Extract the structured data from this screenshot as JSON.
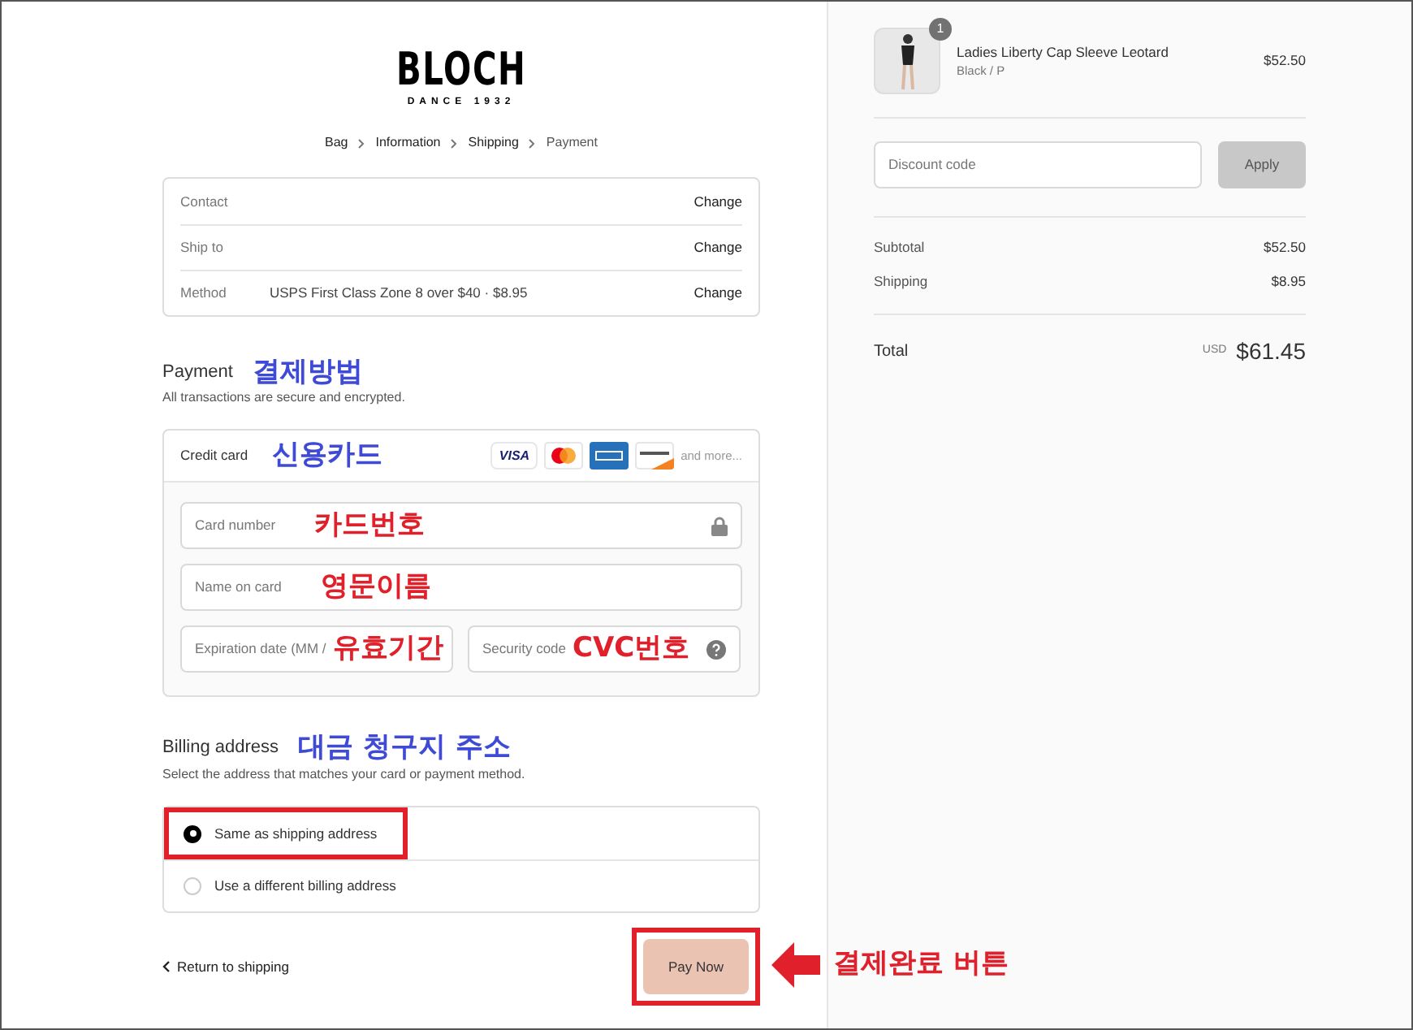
{
  "logo": {
    "name": "BLOCH",
    "tagline": "DANCE 1932"
  },
  "breadcrumb": [
    {
      "label": "Bag",
      "selected": false
    },
    {
      "label": "Information",
      "selected": false
    },
    {
      "label": "Shipping",
      "selected": false
    },
    {
      "label": "Payment",
      "selected": true
    }
  ],
  "review": [
    {
      "label": "Contact",
      "action": "Change"
    },
    {
      "label": "Ship to",
      "action": "Change"
    },
    {
      "label": "Method",
      "value": "USPS First Class Zone 8 over $40 · $8.95",
      "action": "Change"
    }
  ],
  "payment": {
    "title": "Payment",
    "annotation": {
      "text": "결제방법",
      "color": "#3f4ad6"
    },
    "subtitle": "All transactions are secure and encrypted."
  },
  "card": {
    "label": "Credit card",
    "annotation": {
      "text": "신용카드",
      "color": "#3f4ad6"
    },
    "brands": [
      {
        "kind": "visa",
        "text": "VISA"
      },
      {
        "kind": "mastercard"
      },
      {
        "kind": "amex"
      },
      {
        "kind": "discover"
      }
    ],
    "more": "and more...",
    "fields": [
      {
        "placeholder": "Card number",
        "annotation": {
          "text": "카드번호",
          "color": "#e0202a"
        },
        "half": false
      },
      {
        "placeholder": "Name on card",
        "annotation": {
          "text": "영문이름",
          "color": "#e0202a"
        },
        "half": false
      },
      {
        "placeholder": "Expiration date (MM /",
        "annotation": {
          "text": "유효기간",
          "color": "#e0202a"
        },
        "half": true
      },
      {
        "placeholder": "Security code",
        "annotation": {
          "text": "CVC번호",
          "color": "#e0202a"
        },
        "half": true
      }
    ]
  },
  "billing": {
    "title": "Billing address",
    "annotation": {
      "text": "대금 청구지 주소",
      "color": "#3f4ad6"
    },
    "subtitle": "Select the address that matches your card or payment method.",
    "options": [
      {
        "label": "Same as shipping address",
        "selected": true,
        "highlighted": true
      },
      {
        "label": "Use a different billing address",
        "selected": false,
        "highlighted": false
      }
    ]
  },
  "return_link": "Return to shipping",
  "pay": {
    "label": "Pay Now",
    "highlighted": true,
    "annotation": {
      "text": "결제완료 버튼",
      "color": "#e0202a"
    }
  },
  "order": {
    "item": {
      "name": "Ladies Liberty Cap Sleeve Leotard",
      "variant": "Black / P",
      "price": "$52.50",
      "quantity": "1"
    },
    "discount": {
      "placeholder": "Discount code",
      "button": "Apply"
    },
    "summary": [
      {
        "label": "Subtotal",
        "value": "$52.50"
      },
      {
        "label": "Shipping",
        "value": "$8.95"
      }
    ],
    "total": {
      "label": "Total",
      "currency": "USD",
      "amount": "$61.45"
    }
  }
}
